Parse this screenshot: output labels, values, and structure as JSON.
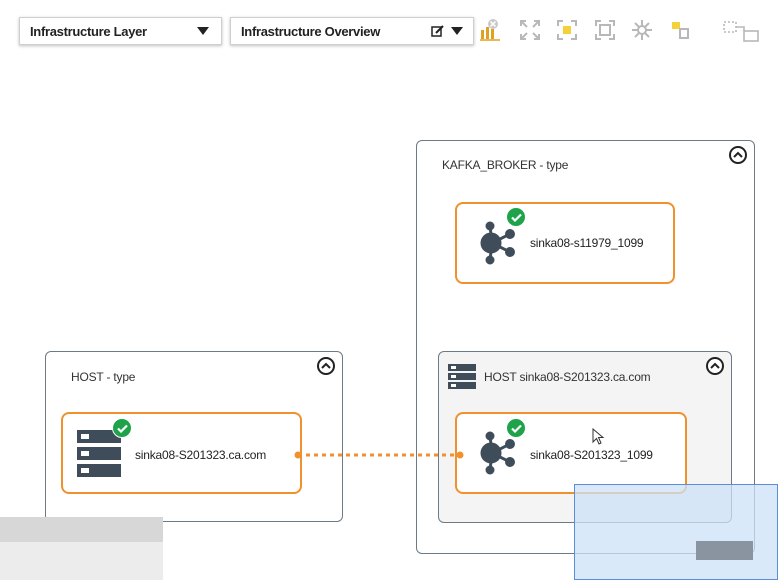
{
  "toolbar": {
    "layer_select": "Infrastructure Layer",
    "view_select": "Infrastructure Overview",
    "icons": [
      "chart-filter-icon",
      "fit-icon",
      "zoom-selection-icon",
      "zoom-fit-icon",
      "layout-icon",
      "move-icon",
      "group-icon"
    ]
  },
  "groups": {
    "kafka": {
      "title": "KAFKA_BROKER - type"
    },
    "host_left": {
      "title": "HOST - type"
    },
    "host_inner": {
      "title": "HOST sinka08-S201323.ca.com"
    }
  },
  "nodes": {
    "kafka_top": {
      "label": "sinka08-s11979_1099",
      "status": "ok"
    },
    "host_server": {
      "label": "sinka08-S201323.ca.com",
      "status": "ok"
    },
    "kafka_inner": {
      "label": "sinka08-S201323_1099",
      "status": "ok"
    }
  },
  "colors": {
    "node_border": "#f0912d",
    "status_ok": "#1fa34a",
    "hub_icon": "#3f4d5a",
    "overview_pane": "#cde1f7"
  }
}
